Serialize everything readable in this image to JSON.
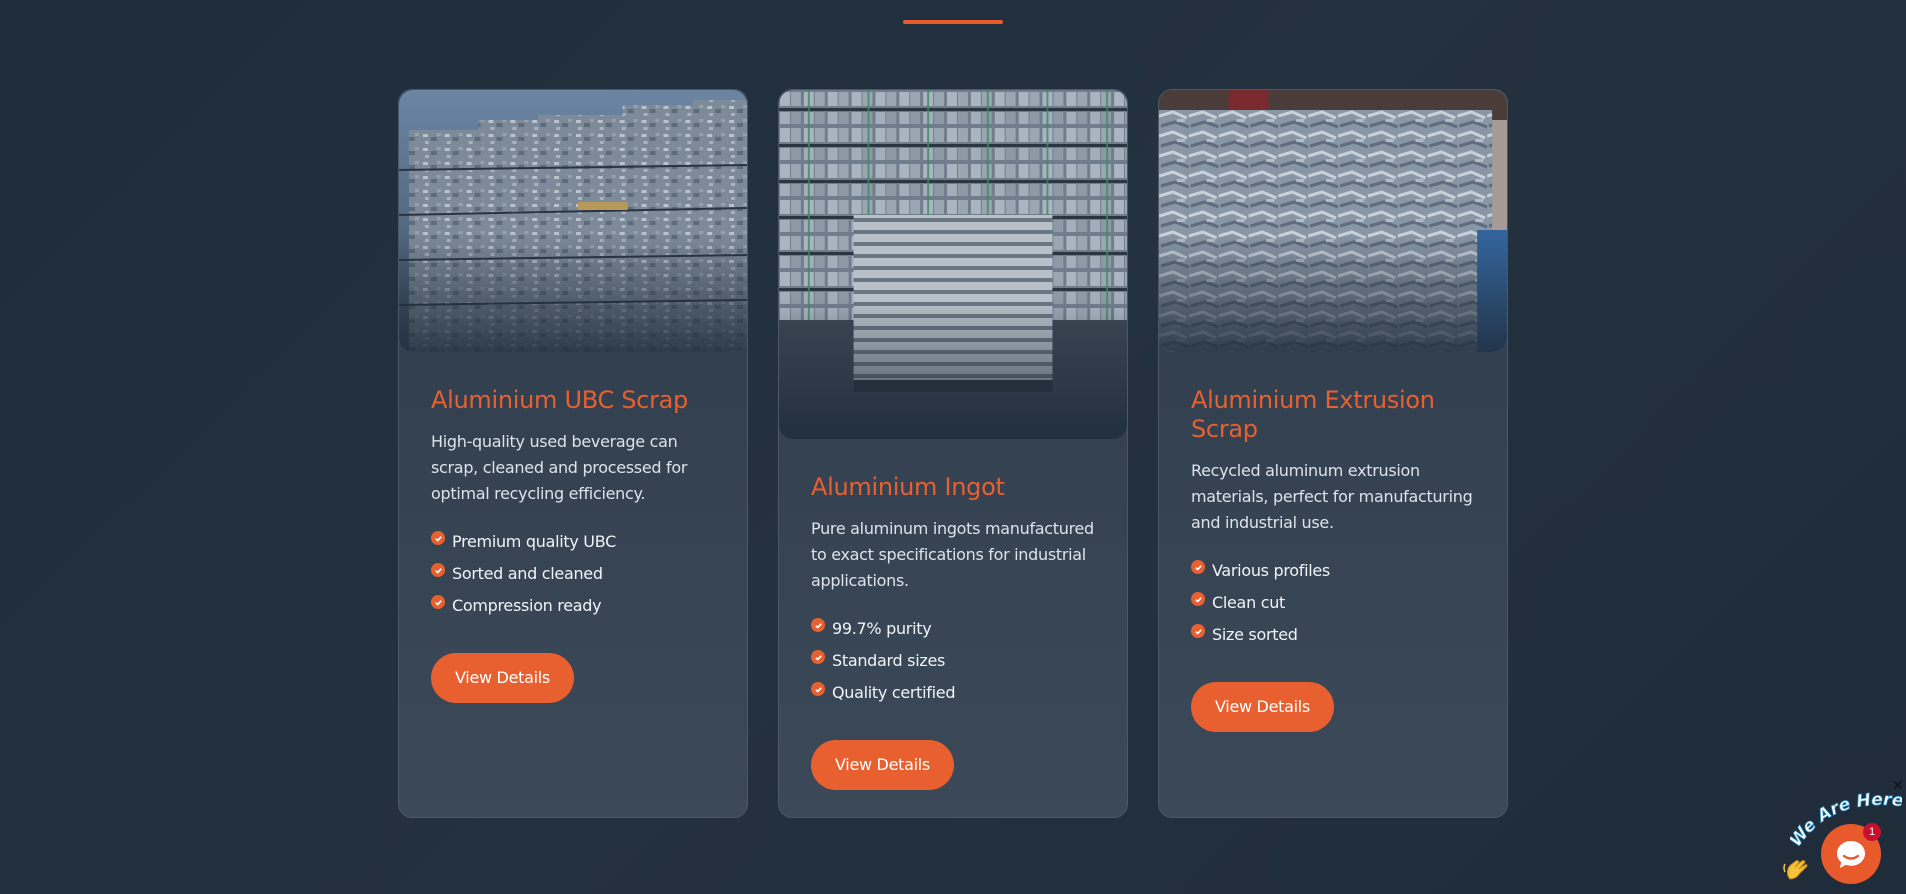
{
  "accent_color": "#e8602f",
  "products": [
    {
      "title": "Aluminium UBC Scrap",
      "description": "High-quality used beverage can scrap, cleaned and processed for optimal recycling efficiency.",
      "features": [
        "Premium quality UBC",
        "Sorted and cleaned",
        "Compression ready"
      ],
      "button_label": "View Details",
      "image": "stacked-can-bales-photo"
    },
    {
      "title": "Aluminium Ingot",
      "description": "Pure aluminum ingots manufactured to exact specifications for industrial applications.",
      "features": [
        "99.7% purity",
        "Standard sizes",
        "Quality certified"
      ],
      "button_label": "View Details",
      "image": "ingot-stack-photo"
    },
    {
      "title": "Aluminium Extrusion Scrap",
      "description": "Recycled aluminum extrusion materials, perfect for manufacturing and industrial use.",
      "features": [
        "Various profiles",
        "Clean cut",
        "Size sorted"
      ],
      "button_label": "View Details",
      "image": "extrusion-scrap-bale-photo"
    }
  ],
  "chat": {
    "tagline": "We Are Here!",
    "badge_count": "1",
    "close_symbol": "✕"
  }
}
